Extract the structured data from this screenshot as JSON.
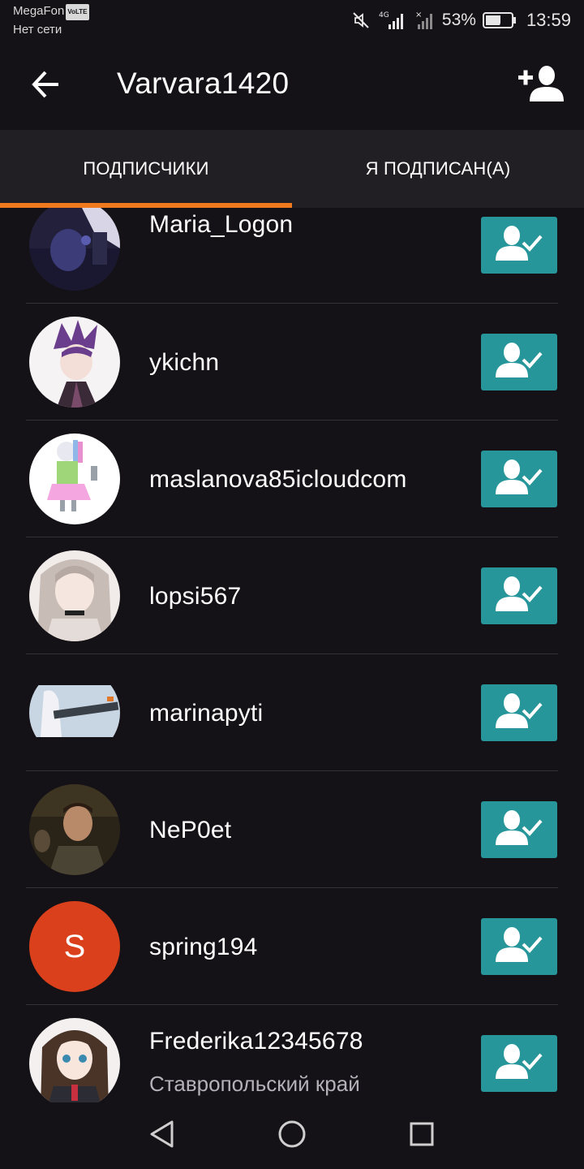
{
  "status_bar": {
    "carrier": "MegaFon",
    "volte_badge": "VoLTE",
    "network_status": "Нет сети",
    "network_type": "4G",
    "battery_percent": "53%",
    "time": "13:59"
  },
  "header": {
    "title": "Varvara1420",
    "back_icon": "arrow-left-icon",
    "add_user_icon": "add-user-icon"
  },
  "tabs": [
    {
      "label": "ПОДПИСЧИКИ",
      "active": true
    },
    {
      "label": "Я ПОДПИСАН(А)",
      "active": false
    }
  ],
  "colors": {
    "background": "#141216",
    "tab_bar": "#211f23",
    "accent_orange": "#ee7a1d",
    "follow_button": "#27969a",
    "letter_avatar": "#d9401b"
  },
  "followers": [
    {
      "username": "Maria_Logon",
      "subtitle": "",
      "followed": true
    },
    {
      "username": "ykichn",
      "subtitle": "",
      "followed": true
    },
    {
      "username": "maslanova85icloudcom",
      "subtitle": "",
      "followed": true
    },
    {
      "username": "lopsi567",
      "subtitle": "",
      "followed": true
    },
    {
      "username": "marinapyti",
      "subtitle": "",
      "followed": true
    },
    {
      "username": "NeP0et",
      "subtitle": "",
      "followed": true
    },
    {
      "username": "spring194",
      "subtitle": "",
      "avatar_letter": "S",
      "followed": true
    },
    {
      "username": "Frederika12345678",
      "subtitle": "Ставропольский край",
      "followed": true
    }
  ],
  "nav_bar": {
    "back_icon": "triangle-back-icon",
    "home_icon": "circle-home-icon",
    "recents_icon": "square-recents-icon"
  }
}
